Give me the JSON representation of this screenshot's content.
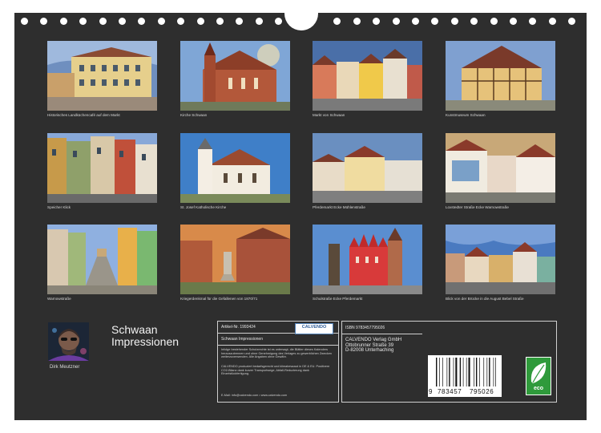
{
  "photos": [
    {
      "caption": "Historisches Landküchencafé auf dem Markt",
      "scene": "town-square"
    },
    {
      "caption": "Kirche Schwaan",
      "scene": "brick-church"
    },
    {
      "caption": "Markt von Schwaan",
      "scene": "colorful-houses"
    },
    {
      "caption": "Kunstmuseum Schwaan",
      "scene": "timber-house"
    },
    {
      "caption": "Speicher Klick",
      "scene": "street-facades"
    },
    {
      "caption": "St. Josef Katholische Kirche",
      "scene": "white-chapel"
    },
    {
      "caption": "Pferdemarkt Ecke Mühlenstraße",
      "scene": "street-corner"
    },
    {
      "caption": "Loxstedter Straße Ecke Warnowstraße",
      "scene": "mural-houses"
    },
    {
      "caption": "Warnowstraße",
      "scene": "narrow-street"
    },
    {
      "caption": "Kriegerdenkmal für die Gefallenen von 1870/71",
      "scene": "war-memorial"
    },
    {
      "caption": "Schulstraße Ecke Pferdemarkt",
      "scene": "red-gable"
    },
    {
      "caption": "Blick von der Brücke in die August Bebel Straße",
      "scene": "street-view"
    }
  ],
  "title_line1": "Schwaan",
  "title_line2": "Impressionen",
  "author": "Dirk Meutzner",
  "article": {
    "label": "Artikel-Nr. 1993424",
    "brand": "CALVENDO",
    "product_title": "Schwaan Impressionen",
    "legal_text": "Infolge bestehender Schutzrechte ist es untersagt, die Blätter dieses Kalenders herauszutrennen und ohne Genehmigung des Verlages zu gewerblichen Zwecken weiterzuverwenden. Alle Angaben ohne Gewähr.",
    "production_text": "CALVENDO produziert bedarfsgerecht und klimabewusst in DE & EU. Positivere CO2-Bilanz dank kurzer Transportwege, Abfall-Reduzierung dank Einzelstückfertigung.",
    "contact": "E-Mail: info@calvendo.com • www.calvendo.com"
  },
  "isbn": "ISBN 9783457795026",
  "publisher": {
    "name": "CALVENDO Verlag GmbH",
    "street": "Ottobrunner Straße 39",
    "city": "D-82008 Unterhaching"
  },
  "barcode_digits": {
    "first": "9",
    "left": "783457",
    "right": "795026"
  },
  "eco_label": "eco",
  "colors": {
    "background": "#2e2e2e",
    "text": "#e6e6e6",
    "eco_green": "#2f9a3b"
  }
}
